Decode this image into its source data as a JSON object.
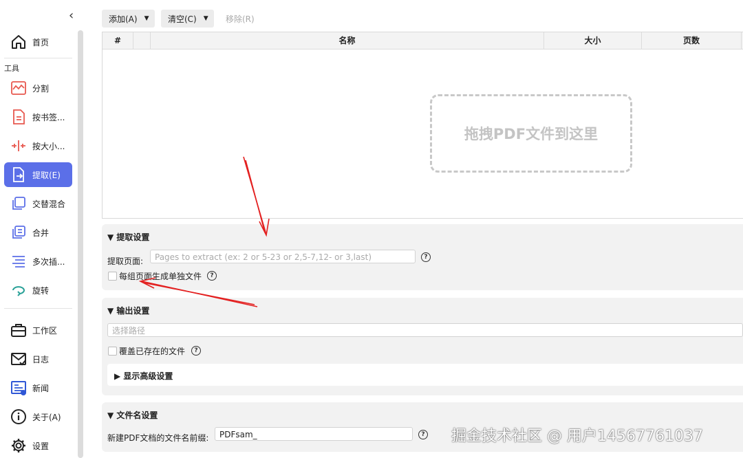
{
  "sidebar": {
    "collapse_glyph": "‹",
    "section_label": "工具",
    "items": [
      {
        "label": "首页",
        "icon": "home-icon"
      },
      {
        "label": "分割",
        "icon": "split-icon"
      },
      {
        "label": "按书签...",
        "icon": "bookmark-split-icon"
      },
      {
        "label": "按大小...",
        "icon": "size-split-icon"
      },
      {
        "label": "提取(E)",
        "icon": "extract-icon"
      },
      {
        "label": "交替混合",
        "icon": "alternate-mix-icon"
      },
      {
        "label": "合并",
        "icon": "merge-icon"
      },
      {
        "label": "多次插...",
        "icon": "multi-insert-icon"
      },
      {
        "label": "旋转",
        "icon": "rotate-icon"
      },
      {
        "label": "工作区",
        "icon": "workspace-icon"
      },
      {
        "label": "日志",
        "icon": "log-icon"
      },
      {
        "label": "新闻",
        "icon": "news-icon"
      },
      {
        "label": "关于(A)",
        "icon": "about-icon"
      },
      {
        "label": "设置",
        "icon": "settings-icon"
      }
    ],
    "active_item": "提取(E)"
  },
  "toolbar": {
    "add_label": "添加(A)",
    "clear_label": "清空(C)",
    "remove_label": "移除(R)"
  },
  "table": {
    "columns": [
      "#",
      "名称",
      "大小",
      "页数"
    ],
    "rows": [],
    "drop_hint": "拖拽PDF文件到这里"
  },
  "extract_settings": {
    "title": "提取设置",
    "pages_label": "提取页面:",
    "pages_placeholder": "Pages to extract (ex: 2 or 5-23 or 2,5-7,12- or 3,last)",
    "separate_files_label": "每组页面生成单独文件"
  },
  "output_settings": {
    "title": "输出设置",
    "path_placeholder": "选择路径",
    "overwrite_label": "覆盖已存在的文件",
    "advanced_label": "显示高级设置"
  },
  "filename_settings": {
    "title": "文件名设置",
    "prefix_label": "新建PDF文档的文件名前缀:",
    "prefix_value": "PDFsam_"
  },
  "watermark": "掘金技术社区 @ 用户14567761037",
  "colors": {
    "accent": "#5b6fe8",
    "icon_red": "#e8584f",
    "icon_teal": "#2aa198",
    "annotation_arrow": "#e32020"
  }
}
